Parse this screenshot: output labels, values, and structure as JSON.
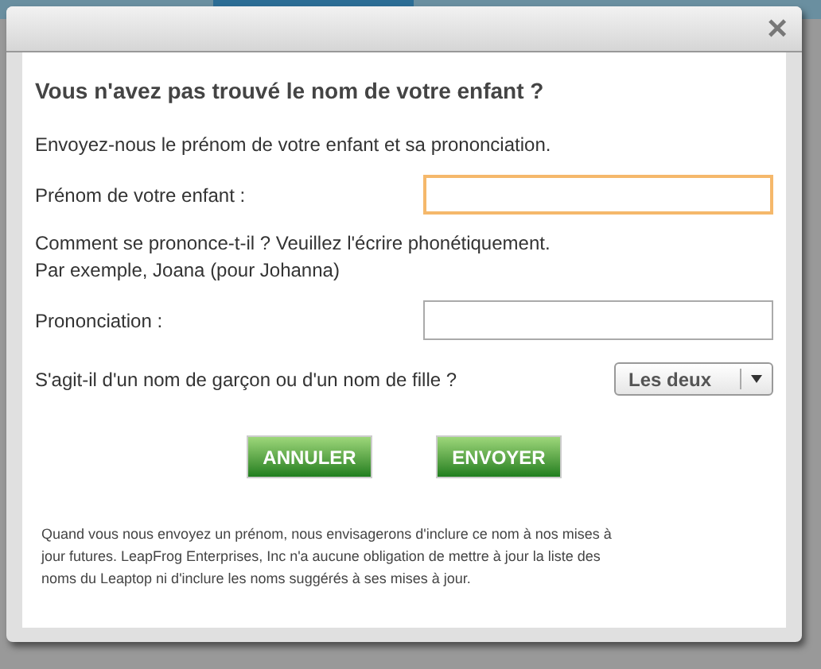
{
  "dialog": {
    "close": "×",
    "title": "Vous n'avez pas trouvé le nom de votre enfant ?",
    "intro": "Envoyez-nous le prénom de votre enfant et sa prononciation.",
    "fields": [
      {
        "label": "Prénom de votre enfant :",
        "focused": true
      },
      {
        "label": "Prononciation :",
        "focused": false
      }
    ],
    "hint_lines": [
      "Comment se prononce-t-il ? Veuillez l'écrire phonétiquement.",
      "Par exemple, Joana (pour Johanna)"
    ],
    "gender": {
      "label": "S'agit-il d'un nom de garçon ou d'un nom de fille ?",
      "value": "Les deux"
    },
    "buttons": [
      "ANNULER",
      "ENVOYER"
    ],
    "disclaimer": "Quand vous nous envoyez un prénom, nous envisagerons d'inclure ce nom à nos mises à jour futures. LeapFrog Enterprises, Inc n'a aucune obligation de mettre à jour la liste des noms du Leaptop ni d'inclure les noms suggérés à ses mises à jour."
  }
}
